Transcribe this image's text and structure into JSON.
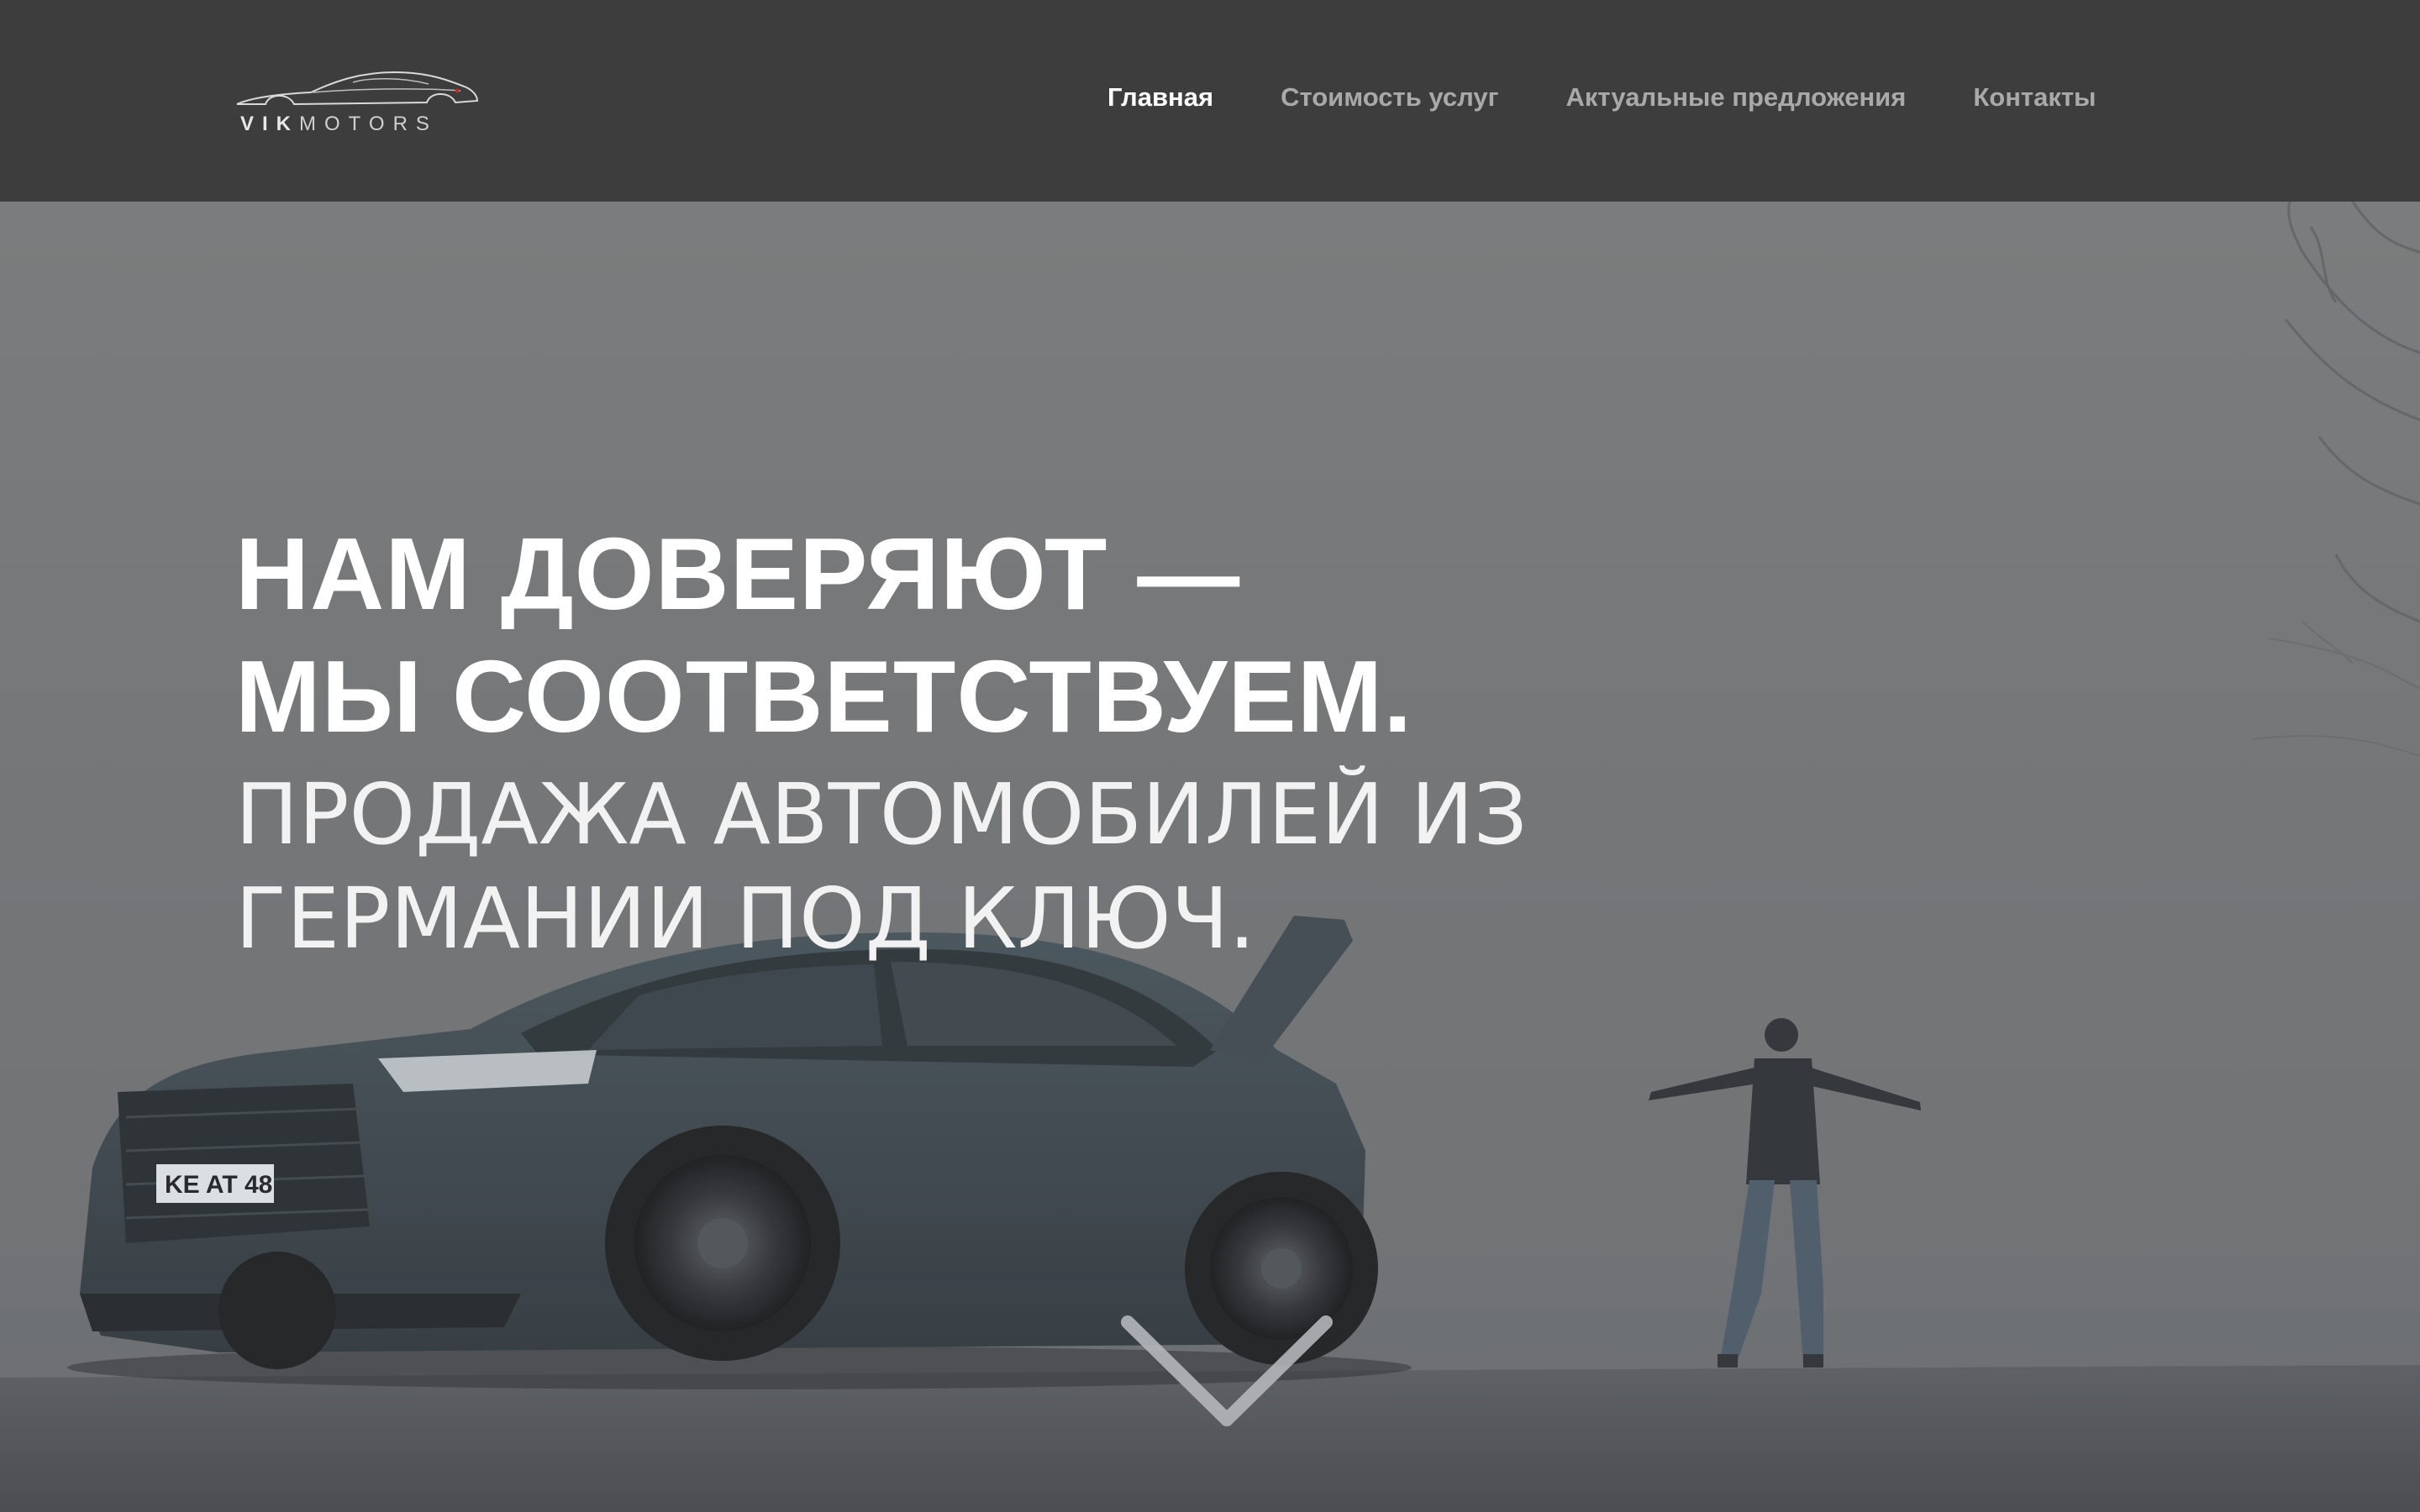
{
  "brand": {
    "logo_vik": "VIK",
    "logo_motors": "MOTORS",
    "logo_icon": "car-silhouette-icon"
  },
  "nav": {
    "items": [
      {
        "label": "Главная",
        "active": true
      },
      {
        "label": "Стоимость услуг",
        "active": false
      },
      {
        "label": "Актуальные предложения",
        "active": false
      },
      {
        "label": "Контакты",
        "active": false
      }
    ]
  },
  "hero": {
    "title_line1": "НАМ ДОВЕРЯЮТ —",
    "title_line2": "МЫ СООТВЕТСТВУЕМ.",
    "subtitle_line1": "ПРОДАЖА АВТОМОБИЛЕЙ ИЗ",
    "subtitle_line2": "ГЕРМАНИИ ПОД КЛЮЧ.",
    "license_plate": "KE AT 48",
    "scroll_icon": "chevron-down-icon"
  },
  "colors": {
    "header_bg": "#3d3d3d",
    "nav_active": "#ffffff",
    "nav_inactive": "#a9a9a9",
    "hero_text": "#ffffff"
  }
}
